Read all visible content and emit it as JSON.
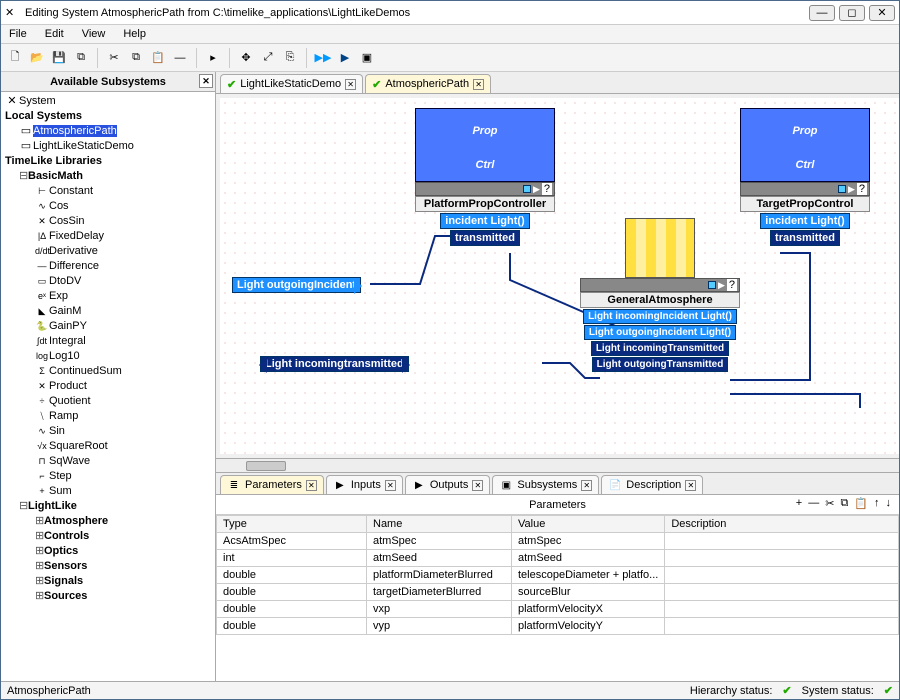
{
  "window": {
    "title": "Editing System AtmosphericPath from C:\\timelike_applications\\LightLikeDemos"
  },
  "menu": {
    "file": "File",
    "edit": "Edit",
    "view": "View",
    "help": "Help"
  },
  "sidebar": {
    "title": "Available Subsystems",
    "root": "System",
    "local_hdr": "Local Systems",
    "local": [
      "AtmosphericPath",
      "LightLikeStaticDemo"
    ],
    "lib_hdr": "TimeLike Libraries",
    "basicmath_hdr": "BasicMath",
    "basicmath": [
      "Constant",
      "Cos",
      "CosSin",
      "FixedDelay",
      "Derivative",
      "Difference",
      "DtoDV",
      "Exp",
      "GainM",
      "GainPY",
      "Integral",
      "Log10",
      "ContinuedSum",
      "Product",
      "Quotient",
      "Ramp",
      "Sin",
      "SquareRoot",
      "SqWave",
      "Step",
      "Sum"
    ],
    "basicmath_icons": [
      "⊢",
      "∿",
      "✕",
      "|Δ",
      "d/dt",
      "—",
      "▭",
      "eˣ",
      "◣",
      "🐍",
      "∫dt",
      "log",
      "Σ",
      "✕",
      "÷",
      "⧹",
      "∿",
      "√x",
      "⊓",
      "⌐",
      "+"
    ],
    "lightlike_hdr": "LightLike",
    "lightlike": [
      "Atmosphere",
      "Controls",
      "Optics",
      "Sensors",
      "Signals",
      "Sources"
    ]
  },
  "editor_tabs": [
    {
      "label": "LightLikeStaticDemo",
      "active": false
    },
    {
      "label": "AtmosphericPath",
      "active": true
    }
  ],
  "canvas": {
    "propctrl": "Prop\nCtrl",
    "platform_name": "PlatformPropController",
    "target_name": "TargetPropControl",
    "atm_name": "GeneralAtmosphere",
    "port_incident": "incident Light()",
    "port_transmitted": "transmitted",
    "flag_out_inc": "Light outgoingIncident",
    "flag_in_trans": "Light incomingtransmitted",
    "atm_p1": "Light incomingIncident Light()",
    "atm_p2": "Light outgoingIncident Light()",
    "atm_p3": "Light incomingTransmitted",
    "atm_p4": "Light outgoingTransmitted"
  },
  "bottom_tabs": [
    {
      "label": "Parameters",
      "icon": "≣",
      "active": true
    },
    {
      "label": "Inputs",
      "icon": "▶",
      "active": false
    },
    {
      "label": "Outputs",
      "icon": "▶",
      "active": false
    },
    {
      "label": "Subsystems",
      "icon": "▣",
      "active": false
    },
    {
      "label": "Description",
      "icon": "📄",
      "active": false
    }
  ],
  "params": {
    "title": "Parameters",
    "cols": [
      "Type",
      "Name",
      "Value",
      "Description"
    ],
    "rows": [
      [
        "AcsAtmSpec",
        "atmSpec",
        "atmSpec",
        ""
      ],
      [
        "int",
        "atmSeed",
        "atmSeed",
        ""
      ],
      [
        "double",
        "platformDiameterBlurred",
        "telescopeDiameter + platfo...",
        ""
      ],
      [
        "double",
        "targetDiameterBlurred",
        "sourceBlur",
        ""
      ],
      [
        "double",
        "vxp",
        "platformVelocityX",
        ""
      ],
      [
        "double",
        "vyp",
        "platformVelocityY",
        ""
      ]
    ]
  },
  "status": {
    "path": "AtmosphericPath",
    "hier": "Hierarchy status:",
    "sys": "System status:"
  }
}
